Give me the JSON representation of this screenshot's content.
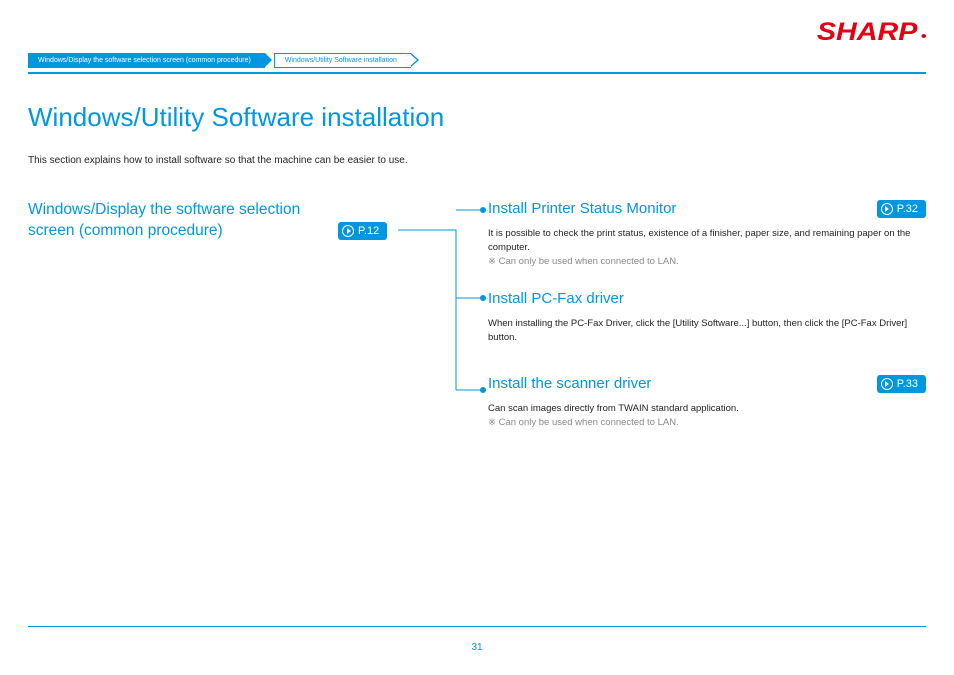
{
  "logo": "SHARP",
  "breadcrumb": {
    "items": [
      "Windows/Display the software selection screen (common procedure)",
      "Windows/Utility Software installation"
    ]
  },
  "title": "Windows/Utility Software installation",
  "intro": "This section explains how to install software so that the machine can be easier to use.",
  "left": {
    "heading": "Windows/Display the software selection screen (common procedure)",
    "page": "P.12"
  },
  "sections": [
    {
      "heading": "Install Printer Status Monitor",
      "page": "P.32",
      "desc": "It is possible to check the print status, existence of a finisher, paper size, and remaining paper on the computer.",
      "note": "※ Can only be used when connected to LAN."
    },
    {
      "heading": "Install PC-Fax driver",
      "page": "",
      "desc": "When installing the PC-Fax Driver, click the [Utility Software...] button, then click the [PC-Fax Driver] button.",
      "note": ""
    },
    {
      "heading": "Install the scanner driver",
      "page": "P.33",
      "desc": "Can scan images directly from TWAIN standard application.",
      "note": "※ Can only be used when connected to LAN."
    }
  ],
  "page_number": "31"
}
